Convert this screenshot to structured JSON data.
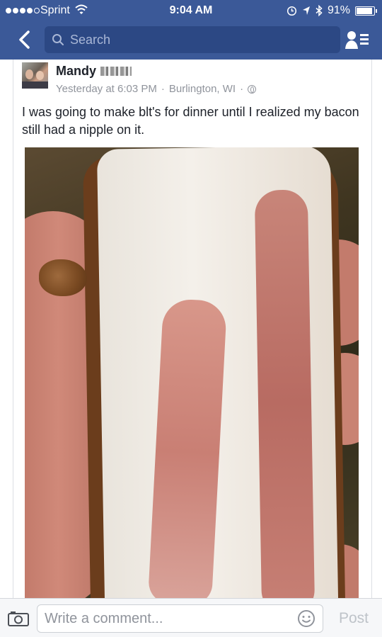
{
  "status_bar": {
    "carrier": "Sprint",
    "time": "9:04 AM",
    "battery": "91%"
  },
  "nav": {
    "search_placeholder": "Search"
  },
  "post": {
    "author": "Mandy",
    "timestamp": "Yesterday at 6:03 PM",
    "location": "Burlington, WI",
    "separator": "·",
    "text": "I was going to make blt's for dinner until I realized my bacon still had a nipple on it."
  },
  "comment_bar": {
    "placeholder": "Write a comment...",
    "post_label": "Post"
  },
  "colors": {
    "brand": "#3b5998",
    "meta_text": "#90949c",
    "post_button_disabled": "#bec3c9"
  },
  "icons": [
    "back-icon",
    "search-icon",
    "friend-requests-icon",
    "wifi-icon",
    "alarm-icon",
    "location-arrow-icon",
    "bluetooth-icon",
    "battery-icon",
    "globe-icon",
    "camera-icon",
    "smiley-icon"
  ]
}
